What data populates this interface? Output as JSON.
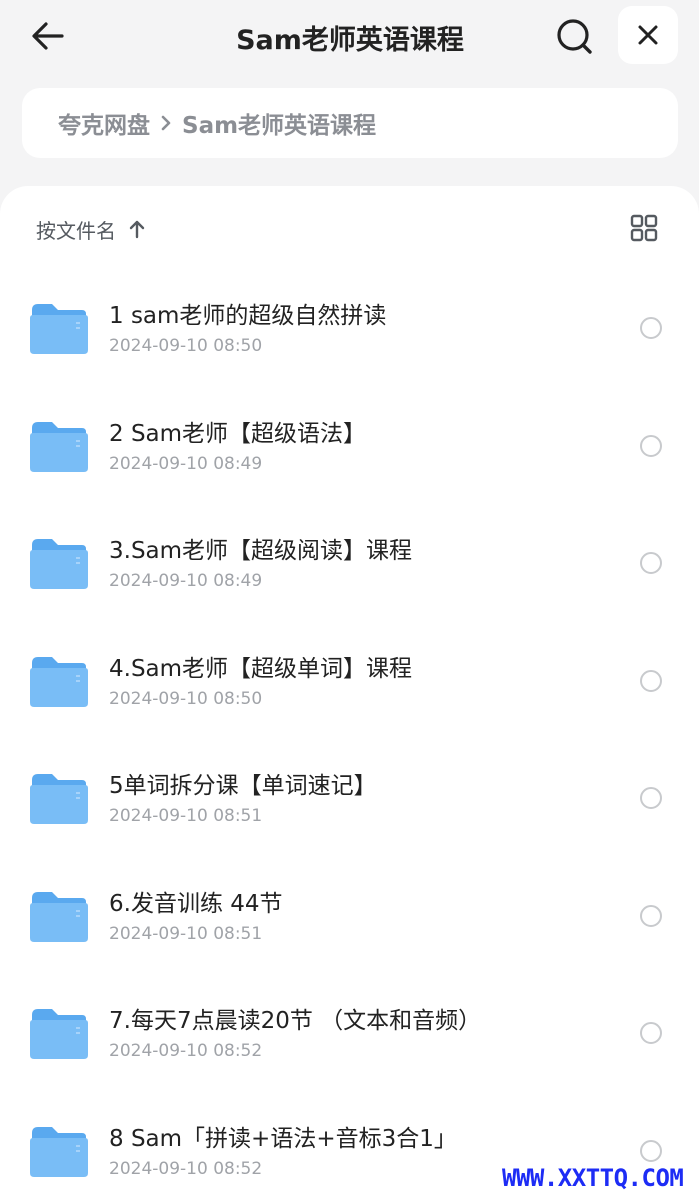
{
  "header": {
    "title": "Sam老师英语课程",
    "back_icon": "arrow-left-icon",
    "search_icon": "search-icon",
    "close_icon": "close-icon"
  },
  "breadcrumb": {
    "root": "夸克网盘",
    "current": "Sam老师英语课程"
  },
  "toolbar": {
    "sort_label": "按文件名",
    "sort_icon": "arrow-up-icon",
    "view_icon": "grid-view-icon"
  },
  "files": [
    {
      "name": "1  sam老师的超级自然拼读",
      "date": "2024-09-10 08:50"
    },
    {
      "name": "2 Sam老师【超级语法】",
      "date": "2024-09-10 08:49"
    },
    {
      "name": "3.Sam老师【超级阅读】课程",
      "date": "2024-09-10 08:49"
    },
    {
      "name": "4.Sam老师【超级单词】课程",
      "date": "2024-09-10 08:50"
    },
    {
      "name": "5单词拆分课【单词速记】",
      "date": "2024-09-10 08:51"
    },
    {
      "name": "6.发音训练  44节",
      "date": "2024-09-10 08:51"
    },
    {
      "name": "7.每天7点晨读20节 （文本和音频）",
      "date": "2024-09-10 08:52"
    },
    {
      "name": "8 Sam「拼读+语法+音标3合1」",
      "date": "2024-09-10 08:52"
    }
  ],
  "watermark": "WWW.XXTTQ.COM",
  "colors": {
    "background": "#f4f4f5",
    "folder_front": "#79bdf6",
    "folder_back": "#5aa9ef",
    "watermark": "#1d2cf5"
  }
}
